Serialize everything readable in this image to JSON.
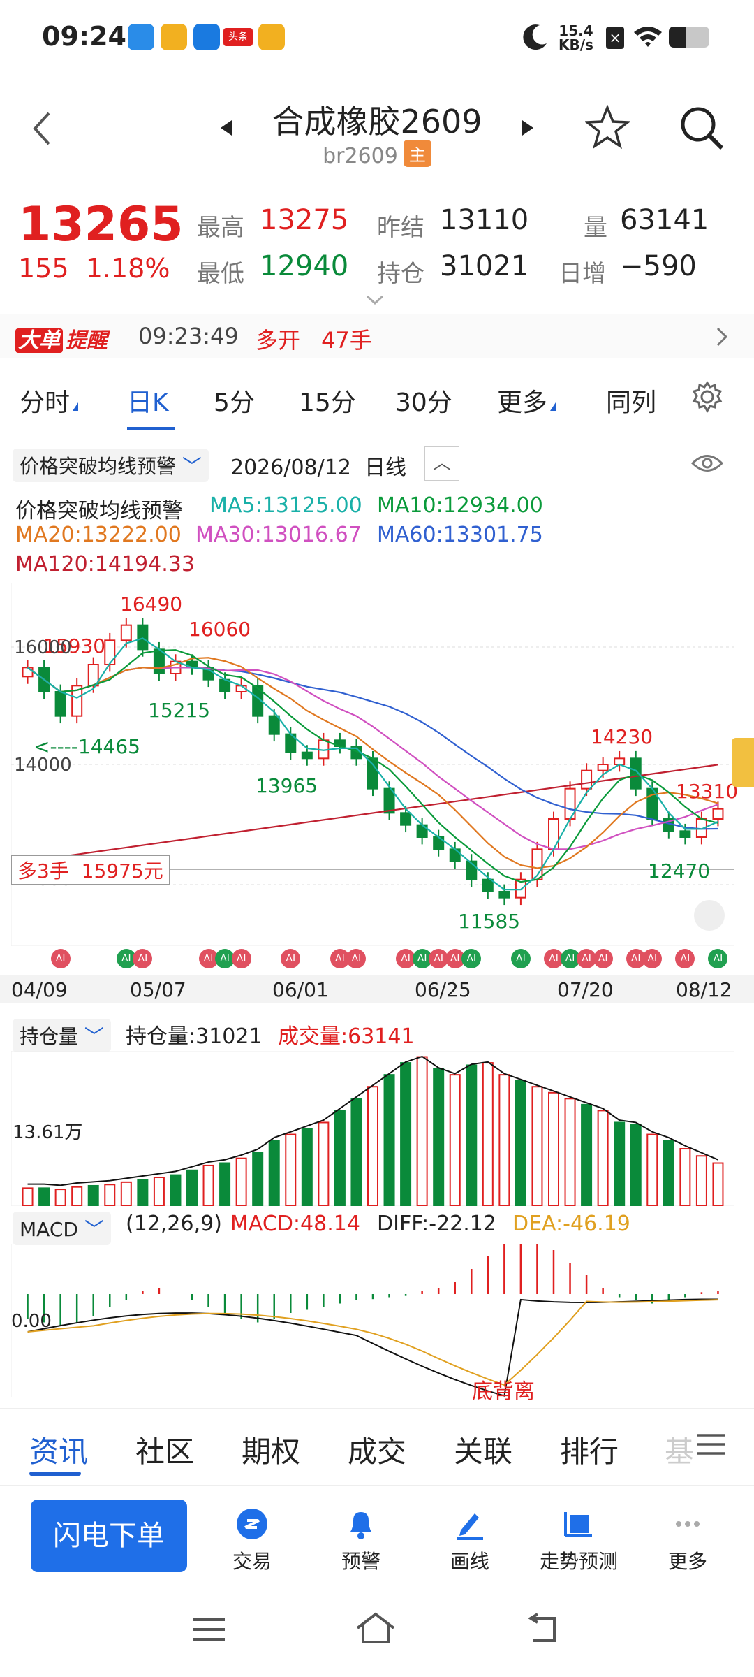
{
  "status": {
    "time": "09:24",
    "net_speed": "15.4",
    "net_unit": "KB/s",
    "news_label": "头条"
  },
  "header": {
    "title": "合成橡胶2609",
    "code": "br2609",
    "main_badge": "主"
  },
  "quote": {
    "last": "13265",
    "change": "155",
    "change_pct": "1.18%",
    "high_label": "最高",
    "high": "13275",
    "low_label": "最低",
    "low": "12940",
    "prev_settle_label": "昨结",
    "prev_settle": "13110",
    "open_int_label": "持仓",
    "open_int": "31021",
    "volume_label": "量",
    "volume": "63141",
    "daily_change_label": "日增",
    "daily_change": "−590"
  },
  "alert": {
    "badge1": "大单",
    "badge2": "提醒",
    "time": "09:23:49",
    "action": "多开",
    "lots": "47手"
  },
  "ktabs": [
    "分时",
    "日K",
    "5分",
    "15分",
    "30分",
    "更多",
    "同列"
  ],
  "active_tab": "日K",
  "chart_header": {
    "indicator": "价格突破均线预警",
    "date": "2026/08/12",
    "period": "日线"
  },
  "ma": {
    "name": "价格突破均线预警",
    "ma5": "MA5:13125.00",
    "ma10": "MA10:12934.00",
    "ma20": "MA20:13222.00",
    "ma30": "MA30:13016.67",
    "ma60": "MA60:13301.75",
    "ma120": "MA120:14194.33"
  },
  "price_labels": {
    "p16490": "16490",
    "p16060": "16060",
    "p15930": "15930",
    "p16000": "16000",
    "p15215": "15215",
    "p14465": "14465",
    "p14000": "14000",
    "p13965": "13965",
    "p14230": "14230",
    "p13310": "13310",
    "p12470": "12470",
    "p11585": "11585",
    "p12000": "12000"
  },
  "position_tag": {
    "side": "多3手",
    "price": "15975元"
  },
  "x_dates": [
    "04/09",
    "05/07",
    "06/01",
    "06/25",
    "07/20",
    "08/12"
  ],
  "vol_header": {
    "selector": "持仓量",
    "oi": "持仓量:31021",
    "vol": "成交量:63141"
  },
  "vol_axis": "13.61万",
  "macd_header": {
    "selector": "MACD",
    "params": "(12,26,9)",
    "macd": "MACD:48.14",
    "diff": "DIFF:-22.12",
    "dea": "DEA:-46.19"
  },
  "macd_axis": "0.00",
  "macd_note": "底背离",
  "ai_label": "AI",
  "infotabs": [
    "资讯",
    "社区",
    "期权",
    "成交",
    "关联",
    "排行",
    "基"
  ],
  "actions": {
    "primary": "闪电下单",
    "items": [
      "交易",
      "预警",
      "画线",
      "走势预测",
      "更多"
    ]
  },
  "colors": {
    "up": "#e02020",
    "down": "#0a8a3a",
    "accent": "#2060d0",
    "ma5": "#19b0a8",
    "ma10": "#0a9a3a",
    "ma20": "#e07820",
    "ma30": "#d050c0",
    "ma60": "#3060d0",
    "ma120": "#c02030",
    "dea": "#e0a020"
  },
  "chart_data": {
    "type": "candlestick",
    "x": [
      "04/09",
      "05/07",
      "06/01",
      "06/25",
      "07/20",
      "08/12"
    ],
    "y_ticks": [
      12000,
      14000,
      16000
    ],
    "annotated_extremes": {
      "high_max": 16490,
      "low_min": 11585,
      "recent_high": 14230,
      "recent_low": 12470,
      "last_close": 13265
    },
    "close_series": [
      15600,
      15200,
      14800,
      15300,
      15650,
      16050,
      16300,
      15900,
      15500,
      15700,
      15600,
      15400,
      15200,
      15300,
      14800,
      14500,
      14200,
      14100,
      14400,
      14300,
      14100,
      13600,
      13200,
      13000,
      12800,
      12600,
      12400,
      12100,
      11900,
      11800,
      12100,
      12600,
      13100,
      13600,
      13900,
      14000,
      14100,
      13600,
      13100,
      12900,
      12800,
      13100,
      13265
    ],
    "volume_series": [
      15,
      15,
      14,
      16,
      17,
      18,
      20,
      22,
      24,
      26,
      30,
      34,
      36,
      40,
      45,
      55,
      60,
      65,
      70,
      80,
      90,
      100,
      110,
      120,
      125,
      115,
      110,
      118,
      120,
      110,
      105,
      100,
      95,
      90,
      85,
      80,
      70,
      68,
      60,
      55,
      48,
      42,
      36
    ],
    "volume_up": [
      true,
      false,
      true,
      true,
      false,
      true,
      true,
      false,
      true,
      false,
      false,
      true,
      false,
      true,
      false,
      false,
      true,
      false,
      true,
      false,
      false,
      true,
      false,
      false,
      true,
      false,
      true,
      false,
      true,
      true,
      false,
      true,
      true,
      true,
      false,
      true,
      false,
      false,
      true,
      false,
      true,
      true,
      true
    ],
    "macd_hist": [
      -40,
      -45,
      -50,
      -45,
      -35,
      -20,
      -10,
      5,
      10,
      0,
      -10,
      -20,
      -30,
      -40,
      -45,
      -40,
      -30,
      -25,
      -20,
      -15,
      -10,
      -8,
      -5,
      -3,
      5,
      10,
      20,
      40,
      60,
      80,
      90,
      85,
      70,
      50,
      30,
      10,
      -5,
      -10,
      -15,
      -10,
      -5,
      3,
      5
    ]
  }
}
